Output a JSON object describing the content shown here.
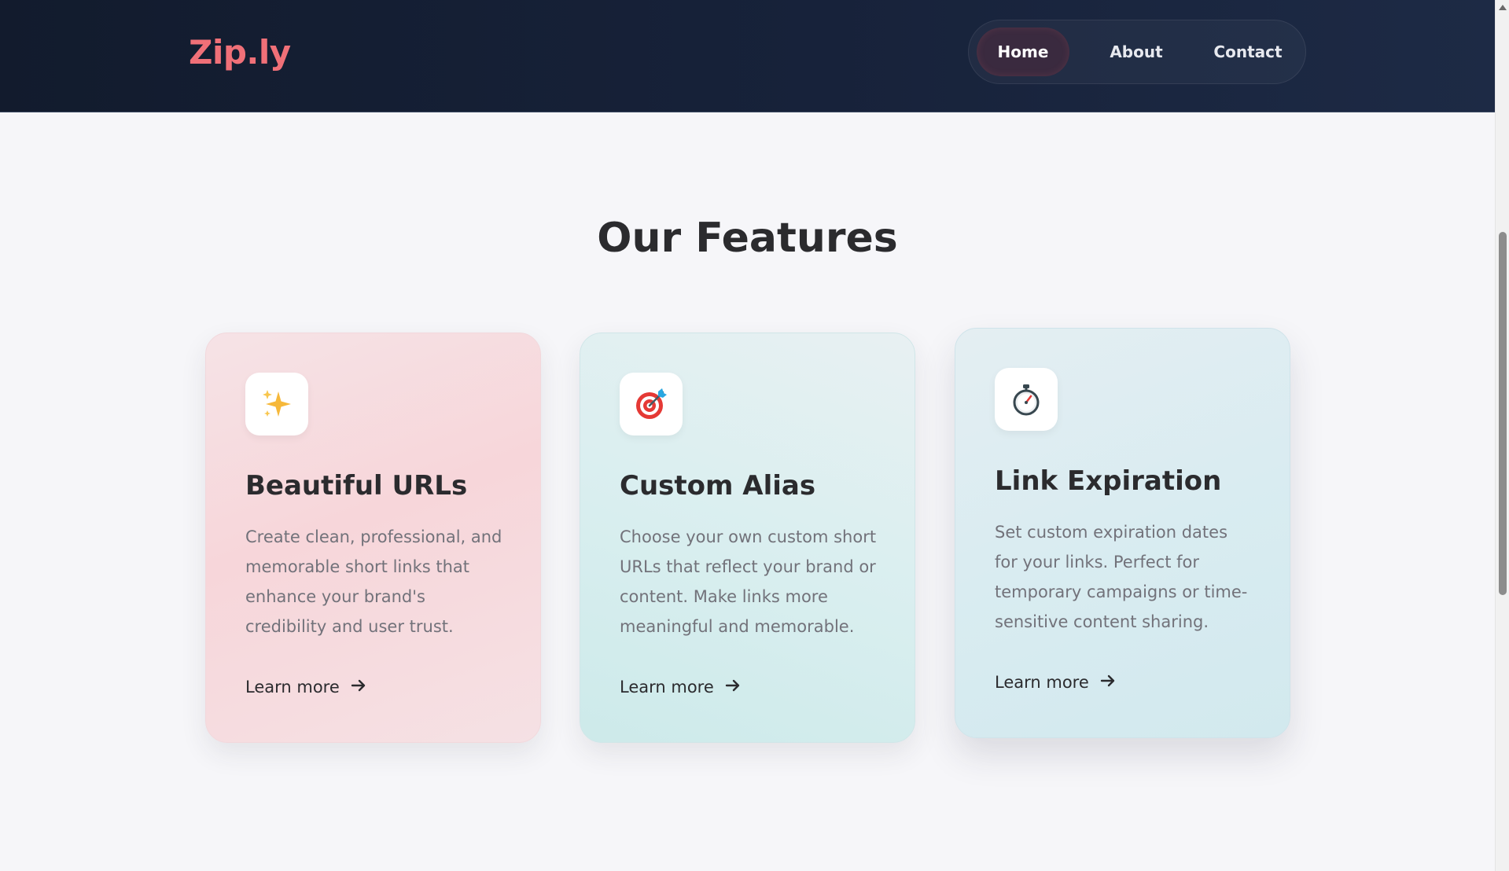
{
  "header": {
    "logo": "Zip.ly",
    "nav": [
      {
        "label": "Home",
        "active": true
      },
      {
        "label": "About",
        "active": false
      },
      {
        "label": "Contact",
        "active": false
      }
    ]
  },
  "features": {
    "title": "Our Features",
    "cards": [
      {
        "icon": "sparkles-icon",
        "title": "Beautiful URLs",
        "description": "Create clean, professional, and memorable short links that enhance your brand's credibility and user trust.",
        "link": "Learn more"
      },
      {
        "icon": "target-icon",
        "title": "Custom Alias",
        "description": "Choose your own custom short URLs that reflect your brand or content. Make links more meaningful and memorable.",
        "link": "Learn more"
      },
      {
        "icon": "stopwatch-icon",
        "title": "Link Expiration",
        "description": "Set custom expiration dates for your links. Perfect for temporary campaigns or time-sensitive content sharing.",
        "link": "Learn more"
      }
    ]
  },
  "colors": {
    "brand": "#f07078",
    "header_bg": "#17223a",
    "text_dark": "#2b2b2e",
    "text_muted": "#72727a"
  }
}
